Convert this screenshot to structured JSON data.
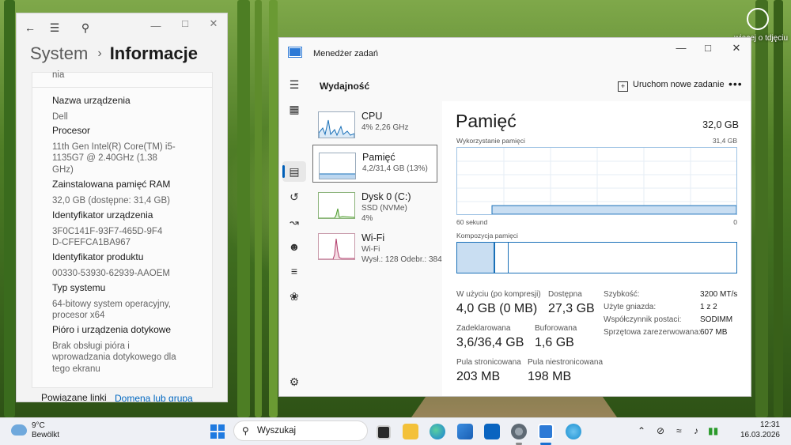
{
  "desktop": {
    "corner_text": "więcej o tdjęciu"
  },
  "settings": {
    "breadcrumb_parent": "System",
    "breadcrumb_current": "Informacje",
    "truncated_text": "nia",
    "specs": [
      {
        "label": "Nazwa urządzenia",
        "value": "Dell"
      },
      {
        "label": "Procesor",
        "value": "11th Gen Intel(R) Core(TM) i5-1135G7 @ 2.40GHz (1.38 GHz)"
      },
      {
        "label": "Zainstalowana pamięć RAM",
        "value": "32,0 GB (dostępne: 31,4 GB)"
      },
      {
        "label": "Identyfikator urządzenia",
        "value": "3F0C141F-93F7-465D-9F4D-CFEFCA1BA967"
      },
      {
        "label": "Identyfikator produktu",
        "value": "00330-53930-62939-AAOEM"
      },
      {
        "label": "Typ systemu",
        "value": "64-bitowy system operacyjny, procesor x64"
      },
      {
        "label": "Pióro i urządzenia dotykowe",
        "value": "Brak obsługi pióra i wprowadzania dotykowego dla tego ekranu"
      }
    ],
    "related_label": "Powiązane linki",
    "related_link": "Domena lub grupa"
  },
  "taskmanager": {
    "title": "Menedżer zadań",
    "section": "Wydajność",
    "new_task": "Uruchom nowe zadanie",
    "more": "•••",
    "resources": [
      {
        "name": "CPU",
        "sub1": "4%  2,26 GHz",
        "sub2": ""
      },
      {
        "name": "Pamięć",
        "sub1": "4,2/31,4 GB (13%)",
        "sub2": ""
      },
      {
        "name": "Dysk 0 (C:)",
        "sub1": "SSD (NVMe)",
        "sub2": "4%"
      },
      {
        "name": "Wi-Fi",
        "sub1": "Wi-Fi",
        "sub2": "Wysł.: 128  Odebr.: 384"
      }
    ],
    "memory": {
      "title": "Pamięć",
      "total": "32,0 GB",
      "usage_label": "Wykorzystanie pamięci",
      "usage_max": "31,4 GB",
      "time_left": "60 sekund",
      "time_right": "0",
      "composition_label": "Kompozycja pamięci",
      "usage_level": 0.13,
      "stats": {
        "in_use_label": "W użyciu (po kompresji)",
        "in_use": "4,0 GB (0 MB)",
        "available_label": "Dostępna",
        "available": "27,3 GB",
        "committed_label": "Zadeklarowana",
        "committed": "3,6/36,4 GB",
        "cached_label": "Buforowana",
        "cached": "1,6 GB",
        "paged_label": "Pula stronicowana",
        "paged": "203 MB",
        "nonpaged_label": "Pula niestronicowana",
        "nonpaged": "198 MB"
      },
      "details": [
        {
          "key": "Szybkość:",
          "value": "3200 MT/s"
        },
        {
          "key": "Użyte gniazda:",
          "value": "1 z 2"
        },
        {
          "key": "Współczynnik postaci:",
          "value": "SODIMM"
        },
        {
          "key": "Sprzętowa zarezerwowana:",
          "value": "607 MB"
        }
      ]
    }
  },
  "taskbar": {
    "temp": "9°C",
    "weather": "Bewölkt",
    "search_placeholder": "Wyszukaj",
    "time": "12:31",
    "date": "16.03.2026"
  }
}
